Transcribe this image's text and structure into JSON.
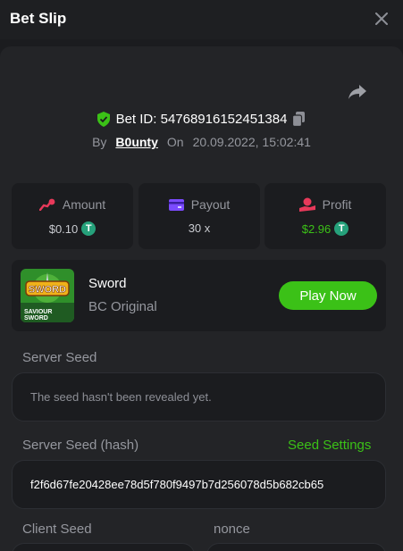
{
  "header": {
    "title": "Bet Slip"
  },
  "bet": {
    "id_label": "Bet ID: 54768916152451384",
    "by_label": "By",
    "user": "B0unty",
    "on_label": "On",
    "datetime": "20.09.2022, 15:02:41"
  },
  "stats": {
    "amount_label": "Amount",
    "amount_value": "$0.10",
    "payout_label": "Payout",
    "payout_value": "30 x",
    "profit_label": "Profit",
    "profit_value": "$2.96",
    "coin_symbol": "T"
  },
  "game": {
    "name": "Sword",
    "provider": "BC Original",
    "thumb_title": "SWORD",
    "thumb_sub1": "SAVIOUR",
    "thumb_sub2": "SWORD",
    "play_label": "Play Now"
  },
  "seeds": {
    "server_seed_label": "Server Seed",
    "server_seed_value": "The seed hasn't been revealed yet.",
    "server_hash_label": "Server Seed (hash)",
    "seed_settings_label": "Seed Settings",
    "server_hash_value": "f2f6d67fe20428ee78d5f780f9497b7d256078d5b682cb65",
    "client_seed_label": "Client Seed",
    "nonce_label": "nonce"
  },
  "colors": {
    "accent_green": "#3bc117",
    "shield_green": "#3bc117",
    "amount_icon": "#e8395a",
    "payout_icon": "#7b4bff",
    "profit_icon": "#e8395a",
    "tether": "#26a17b"
  },
  "icons": [
    "close-icon",
    "share-icon",
    "shield-check-icon",
    "copy-icon",
    "amount-icon",
    "payout-card-icon",
    "profit-icon",
    "tether-icon"
  ]
}
